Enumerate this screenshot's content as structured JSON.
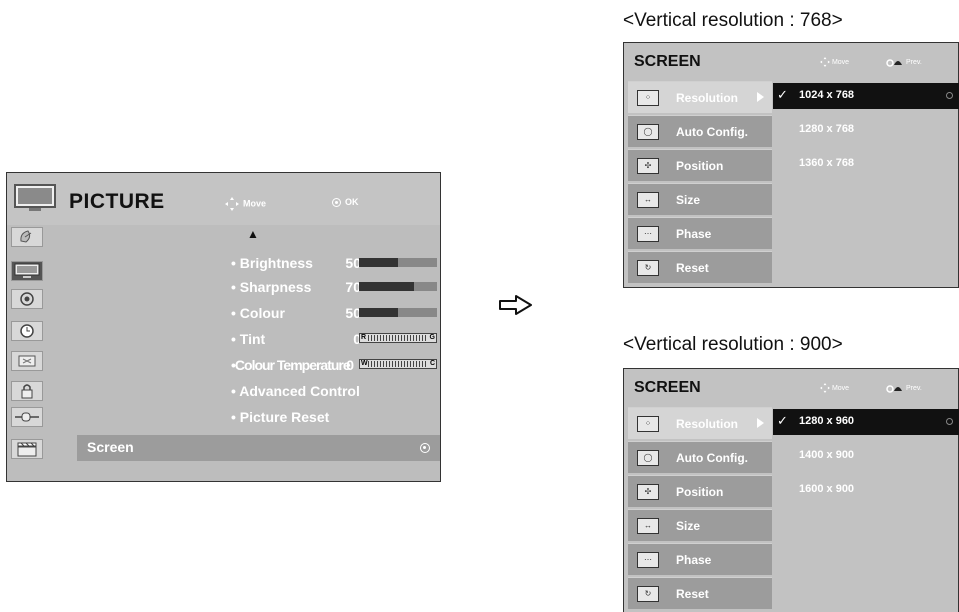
{
  "picture_menu": {
    "title": "PICTURE",
    "hint_move": "Move",
    "hint_ok": "OK",
    "up_arrow": "▲",
    "items": [
      {
        "label": "• Brightness",
        "value": "50",
        "level": 0.5
      },
      {
        "label": "• Sharpness",
        "value": "70",
        "level": 0.7
      },
      {
        "label": "• Colour",
        "value": "50",
        "level": 0.5
      },
      {
        "label": "• Tint",
        "value": "0",
        "left": "R",
        "right": "G"
      },
      {
        "label": "•Colour Temperature",
        "value": "0",
        "left": "W",
        "right": "C"
      },
      {
        "label": "• Advanced Control"
      },
      {
        "label": "• Picture Reset"
      }
    ],
    "selected": "Screen"
  },
  "caption_768": "<Vertical resolution : 768>",
  "caption_900": "<Vertical resolution : 900>",
  "screen_menu_768": {
    "title": "SCREEN",
    "hint_move": "Move",
    "hint_prev": "Prev.",
    "items": [
      "Resolution",
      "Auto Config.",
      "Position",
      "Size",
      "Phase",
      "Reset"
    ],
    "options": [
      "1024 x 768",
      "1280 x 768",
      "1360 x 768"
    ],
    "selected_option": "1024 x 768"
  },
  "screen_menu_900": {
    "title": "SCREEN",
    "hint_move": "Move",
    "hint_prev": "Prev.",
    "items": [
      "Resolution",
      "Auto Config.",
      "Position",
      "Size",
      "Phase",
      "Reset"
    ],
    "options": [
      "1280 x 960",
      "1400 x 900",
      "1600 x 900"
    ],
    "selected_option": "1280 x 960"
  },
  "colors": {
    "menu_bg": "#bdbdbd",
    "selected_row": "#9c9c9c",
    "selected_option": "#111111"
  }
}
